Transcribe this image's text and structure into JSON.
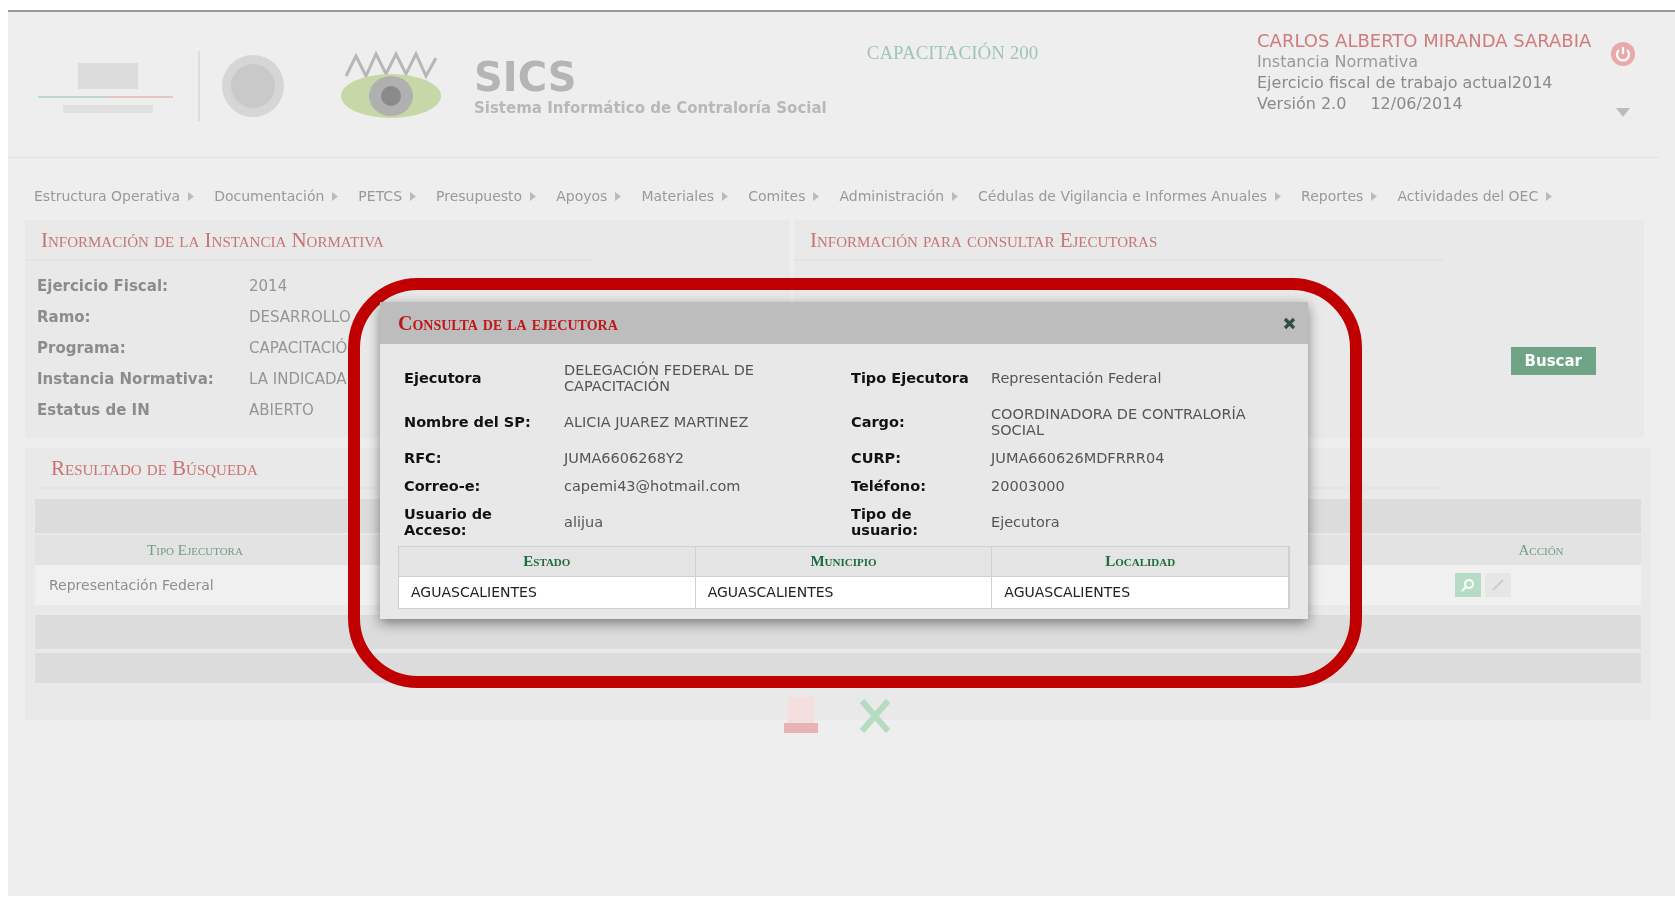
{
  "header": {
    "app_title": "SICS",
    "app_subtitle": "Sistema Informático de Contraloría Social",
    "program": "CAPACITACIÓN 200",
    "user_name": "CARLOS ALBERTO MIRANDA SARABIA",
    "role": "Instancia Normativa",
    "fiscal_year": "Ejercicio fiscal de trabajo actual2014",
    "version": "Versión 2.0",
    "date": "12/06/2014"
  },
  "menu": [
    "Estructura Operativa",
    "Documentación",
    "PETCS",
    "Presupuesto",
    "Apoyos",
    "Materiales",
    "Comites",
    "Administración",
    "Cédulas de Vigilancia e Informes Anuales",
    "Reportes",
    "Actividades del OEC"
  ],
  "instance_panel": {
    "title": "Información de la Instancia Normativa",
    "fields": [
      {
        "label": "Ejercicio Fiscal:",
        "value": "2014"
      },
      {
        "label": "Ramo:",
        "value": "DESARROLLO"
      },
      {
        "label": "Programa:",
        "value": "CAPACITACIÓ"
      },
      {
        "label": "Instancia Normativa:",
        "value": "LA INDICADA"
      },
      {
        "label": "Estatus de IN",
        "value": "ABIERTO"
      }
    ]
  },
  "search_panel": {
    "title": "Información para consultar Ejecutoras",
    "button": "Buscar"
  },
  "results": {
    "title": "Resultado de Búsqueda",
    "columns": [
      "Tipo Ejecutora",
      "Acción"
    ],
    "rows": [
      {
        "tipo": "Representación Federal"
      }
    ]
  },
  "modal": {
    "title": "Consulta de la ejecutora",
    "rows": [
      [
        {
          "label": "Ejecutora",
          "value": "DELEGACIÓN FEDERAL DE CAPACITACIÓN"
        },
        {
          "label": "Tipo Ejecutora",
          "value": "Representación Federal"
        }
      ],
      [
        {
          "label": "Nombre del SP:",
          "value": "ALICIA JUAREZ MARTINEZ"
        },
        {
          "label": "Cargo:",
          "value": "COORDINADORA DE CONTRALORÍA SOCIAL"
        }
      ],
      [
        {
          "label": "RFC:",
          "value": "JUMA6606268Y2"
        },
        {
          "label": "CURP:",
          "value": "JUMA660626MDFRRR04"
        }
      ],
      [
        {
          "label": "Correo-e:",
          "value": "capemi43@hotmail.com"
        },
        {
          "label": "Teléfono:",
          "value": "20003000"
        }
      ],
      [
        {
          "label": "Usuario de Acceso:",
          "value": "alijua"
        },
        {
          "label": "Tipo de usuario:",
          "value": "Ejecutora"
        }
      ]
    ],
    "location_columns": [
      "Estado",
      "Municipio",
      "Localidad"
    ],
    "location_rows": [
      [
        "AGUASCALIENTES",
        "AGUASCALIENTES",
        "AGUASCALIENTES"
      ]
    ]
  }
}
